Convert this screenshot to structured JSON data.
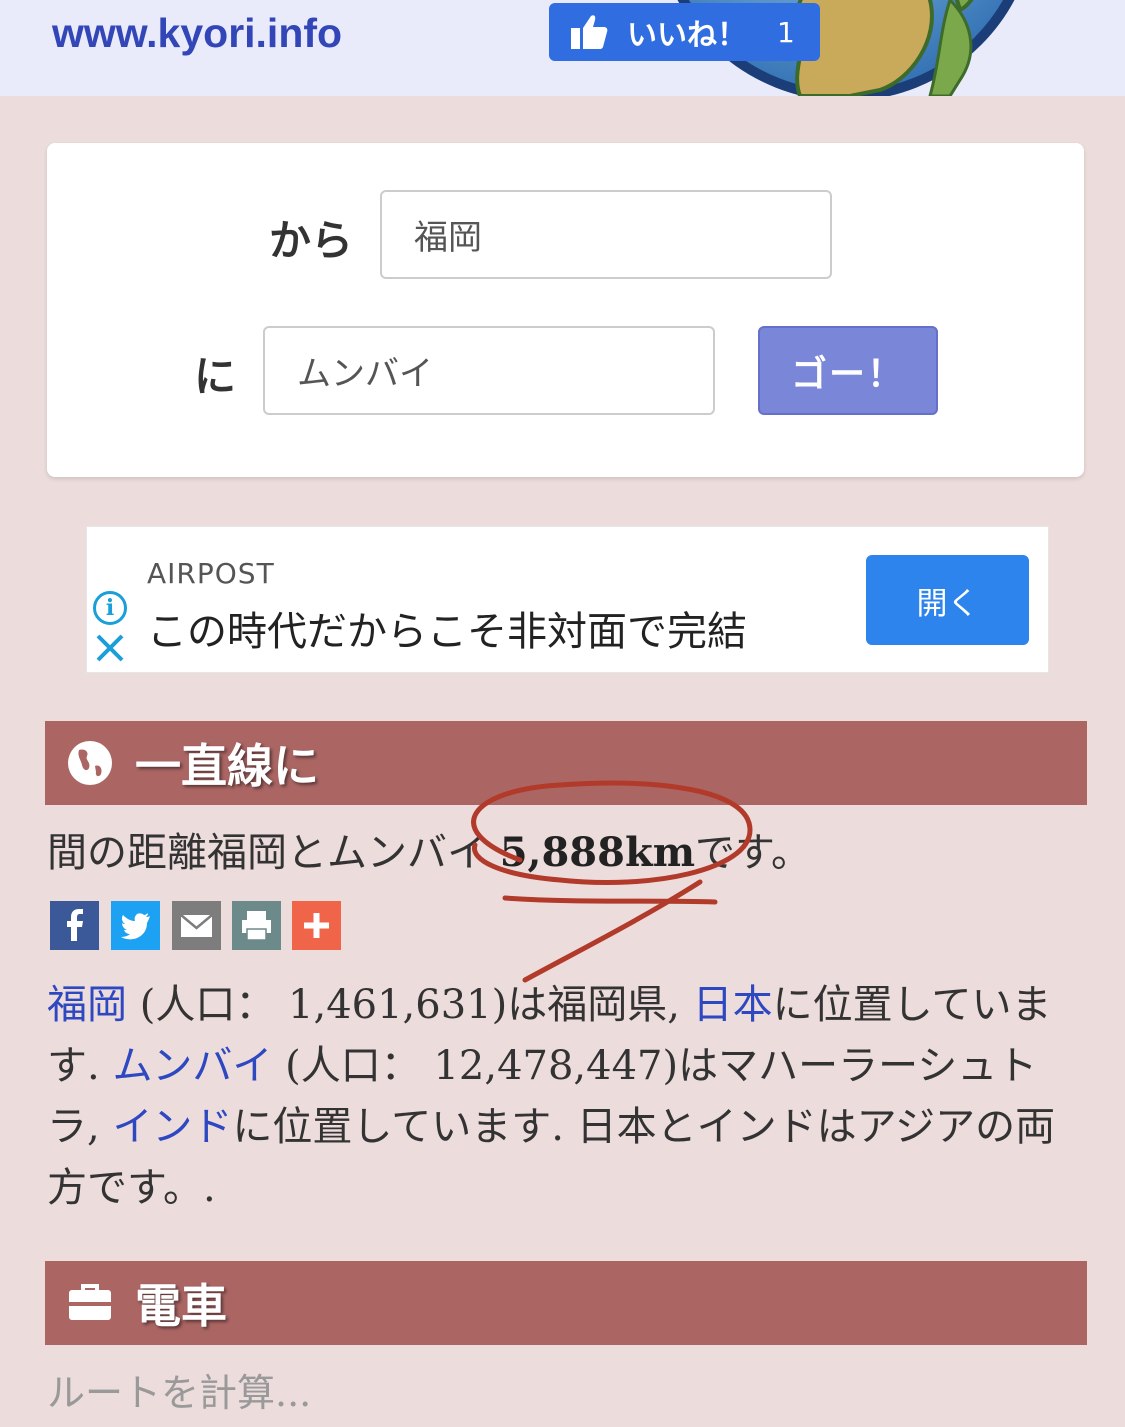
{
  "header": {
    "logo": "www.kyori.info",
    "like_label": "いいね！",
    "like_count": "1"
  },
  "search": {
    "from_label": "から",
    "from_value": "福岡",
    "to_label": "に",
    "to_value": "ムンバイ",
    "go_label": "ゴー！"
  },
  "ad": {
    "brand": "AIRPOST",
    "text": "この時代だからこそ非対面で完結",
    "button": "開く"
  },
  "section_straight": {
    "title": "一直線に",
    "distance_prefix": "間の距離福岡とムンバイ",
    "distance_value": "5,888km",
    "distance_suffix": "です。"
  },
  "share_icons": [
    "facebook-icon",
    "twitter-icon",
    "mail-icon",
    "print-icon",
    "plus-icon"
  ],
  "info": {
    "city1": "福岡",
    "city1_pop": " (人口： 1,461,631)は福岡県, ",
    "country1": "日本",
    "mid1": "に位置しています. ",
    "city2": "ムンバイ",
    "city2_pop": " (人口： 12,478,447)はマハーラーシュトラ, ",
    "country2": "インド",
    "tail": "に位置しています. 日本とインドはアジアの両方です。."
  },
  "section_train": {
    "title": "電車",
    "route_text": "ルートを計算..."
  },
  "colors": {
    "background": "#ecdcdc",
    "header_bg": "#e9eafa",
    "section_head": "#ab6664",
    "link": "#2d48c0",
    "go_button": "#7a86d8",
    "annotation": "#b23a2a"
  }
}
